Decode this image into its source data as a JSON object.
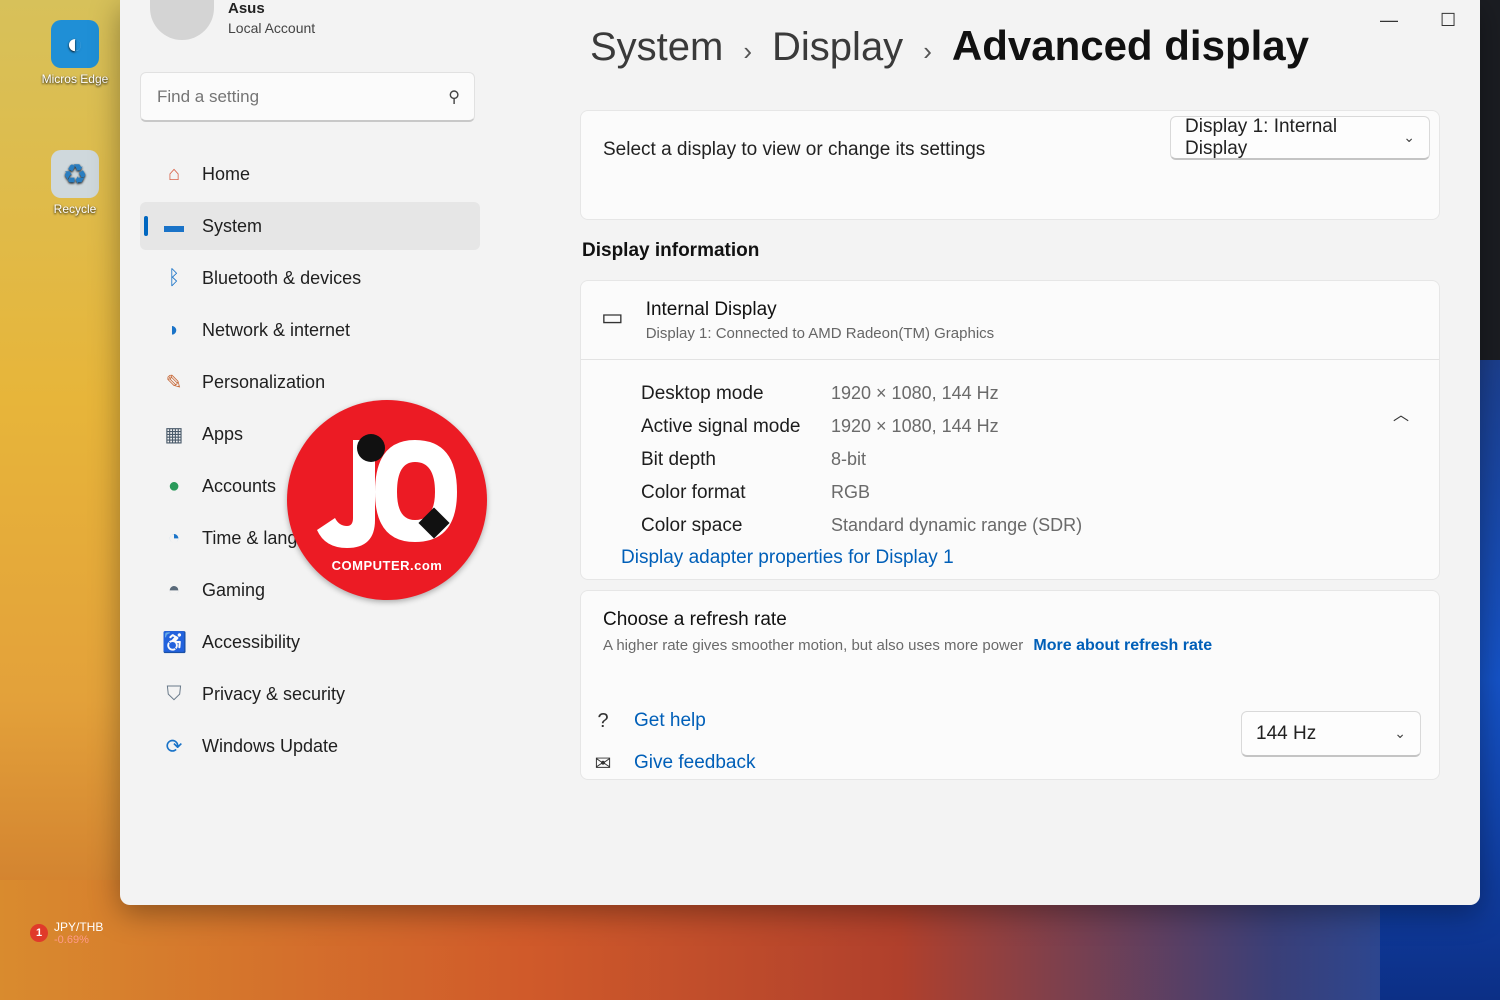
{
  "desktop": {
    "icons": [
      {
        "label": "Micros Edge",
        "icon": "edge-icon"
      },
      {
        "label": "Recycle",
        "icon": "recycle-bin-icon"
      }
    ],
    "taskbar_widget": {
      "badge": "1",
      "pair": "JPY/THB",
      "change": "-0.69%"
    }
  },
  "window": {
    "controls": {
      "minimize": "—",
      "maximize": "☐"
    }
  },
  "sidebar": {
    "profile": {
      "name": "Asus",
      "account_type": "Local Account"
    },
    "search": {
      "placeholder": "Find a setting"
    },
    "items": [
      {
        "label": "Home",
        "icon": "home-icon",
        "active": false
      },
      {
        "label": "System",
        "icon": "system-icon",
        "active": true
      },
      {
        "label": "Bluetooth & devices",
        "icon": "bluetooth-icon",
        "active": false
      },
      {
        "label": "Network & internet",
        "icon": "wifi-icon",
        "active": false
      },
      {
        "label": "Personalization",
        "icon": "brush-icon",
        "active": false
      },
      {
        "label": "Apps",
        "icon": "apps-icon",
        "active": false
      },
      {
        "label": "Accounts",
        "icon": "person-icon",
        "active": false
      },
      {
        "label": "Time & langua",
        "icon": "globe-clock-icon",
        "active": false
      },
      {
        "label": "Gaming",
        "icon": "gamepad-icon",
        "active": false
      },
      {
        "label": "Accessibility",
        "icon": "accessibility-icon",
        "active": false
      },
      {
        "label": "Privacy & security",
        "icon": "shield-icon",
        "active": false
      },
      {
        "label": "Windows Update",
        "icon": "update-icon",
        "active": false
      }
    ]
  },
  "breadcrumb": {
    "part1": "System",
    "part2": "Display",
    "current": "Advanced display",
    "separator": "›"
  },
  "select_display": {
    "text": "Select a display to view or change its settings",
    "dropdown_value": "Display 1: Internal Display"
  },
  "display_info": {
    "section_title": "Display information",
    "title": "Internal Display",
    "subtitle": "Display 1: Connected to AMD Radeon(TM) Graphics",
    "rows": [
      {
        "label": "Desktop mode",
        "value": "1920 × 1080, 144 Hz"
      },
      {
        "label": "Active signal mode",
        "value": "1920 × 1080, 144 Hz"
      },
      {
        "label": "Bit depth",
        "value": "8-bit"
      },
      {
        "label": "Color format",
        "value": "RGB"
      },
      {
        "label": "Color space",
        "value": "Standard dynamic range (SDR)"
      }
    ],
    "adapter_link": "Display adapter properties for Display 1"
  },
  "refresh_rate": {
    "title": "Choose a refresh rate",
    "description": "A higher rate gives smoother motion, but also uses more power",
    "more_link": "More about refresh rate",
    "value": "144 Hz"
  },
  "help": {
    "get_help": "Get help",
    "give_feedback": "Give feedback"
  },
  "watermark": {
    "letters": "JQ",
    "site": "COMPUTER.com"
  },
  "colors": {
    "accent": "#005fb8",
    "logo_red": "#ec1b24",
    "window_bg": "#f3f3f3"
  }
}
